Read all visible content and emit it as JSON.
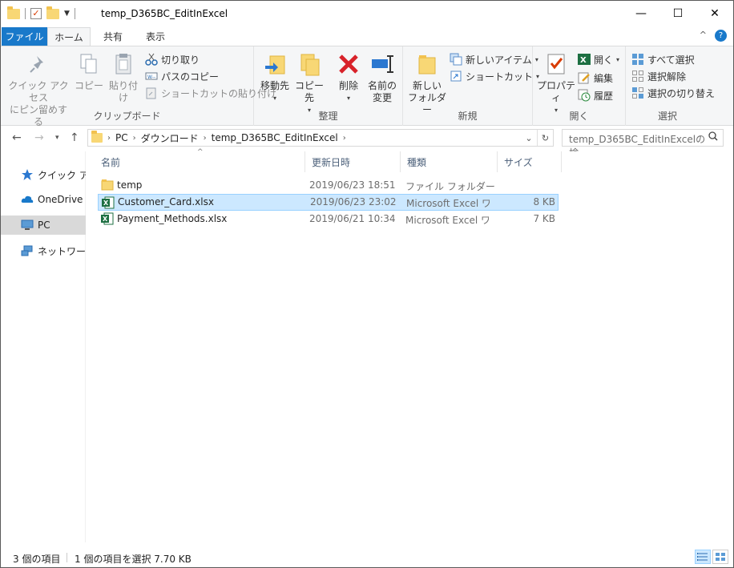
{
  "window": {
    "title": "temp_D365BC_EditInExcel",
    "minimize": "—",
    "maximize": "☐",
    "close": "✕"
  },
  "ribbon_tabs": {
    "file": "ファイル",
    "home": "ホーム",
    "share": "共有",
    "view": "表示",
    "collapse": "^",
    "help": "?"
  },
  "ribbon": {
    "clipboard": {
      "label": "クリップボード",
      "pin_quick_access": "クイック アクセス\nにピン留めする",
      "copy": "コピー",
      "paste": "貼り付け",
      "cut": "切り取り",
      "copy_path": "パスのコピー",
      "paste_shortcut": "ショートカットの貼り付け"
    },
    "organize": {
      "label": "整理",
      "move_to": "移動先",
      "copy_to": "コピー先",
      "delete": "削除",
      "rename": "名前の\n変更"
    },
    "new": {
      "label": "新規",
      "new_folder": "新しい\nフォルダー",
      "new_item": "新しいアイテム",
      "easy_access": "ショートカット"
    },
    "open": {
      "label": "開く",
      "properties": "プロパティ",
      "open": "開く",
      "edit": "編集",
      "history": "履歴"
    },
    "select": {
      "label": "選択",
      "select_all": "すべて選択",
      "select_none": "選択解除",
      "invert": "選択の切り替え"
    }
  },
  "address": {
    "path": [
      "PC",
      "ダウンロード",
      "temp_D365BC_EditInExcel"
    ],
    "search_placeholder": "temp_D365BC_EditInExcelの検..."
  },
  "nav_pane": {
    "items": [
      {
        "label": "クイック アク"
      },
      {
        "label": "OneDrive -"
      },
      {
        "label": "PC"
      },
      {
        "label": "ネットワーク"
      }
    ]
  },
  "columns": {
    "name": "名前",
    "modified": "更新日時",
    "type": "種類",
    "size": "サイズ"
  },
  "files": [
    {
      "name": "temp",
      "modified": "2019/06/23 18:51",
      "type": "ファイル フォルダー",
      "size": "",
      "icon": "folder-icon"
    },
    {
      "name": "Customer_Card.xlsx",
      "modified": "2019/06/23 23:02",
      "type": "Microsoft Excel ワ...",
      "size": "8 KB",
      "icon": "excel-file-icon"
    },
    {
      "name": "Payment_Methods.xlsx",
      "modified": "2019/06/21 10:34",
      "type": "Microsoft Excel ワ...",
      "size": "7 KB",
      "icon": "excel-file-icon"
    }
  ],
  "status": {
    "item_count": "3 個の項目",
    "selection": "1 個の項目を選択  7.70 KB"
  },
  "colors": {
    "file_tab": "#1979ca",
    "selection_bg": "#cce8ff",
    "selection_border": "#99d1ff",
    "folder": "#f8d775",
    "excel": "#1d6f42",
    "delete": "#d8222a"
  }
}
